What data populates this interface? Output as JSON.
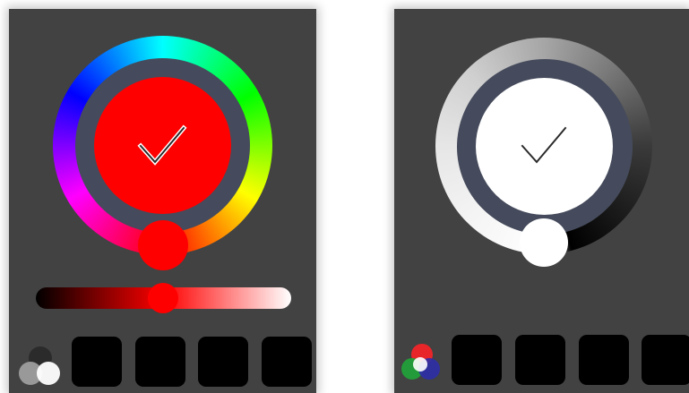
{
  "panels": [
    {
      "mode": "color",
      "selected_color": "#ff0000",
      "slider_position": 0.5,
      "preset_slots": [
        "#000000",
        "#000000",
        "#000000",
        "#000000"
      ],
      "icons": [
        "checkmark-icon",
        "grayscale-mode-icon"
      ]
    },
    {
      "mode": "white",
      "selected_color": "#ffffff",
      "preset_slots": [
        "#000000",
        "#000000",
        "#000000",
        "#000000"
      ],
      "icons": [
        "checkmark-icon",
        "rgb-mode-icon"
      ]
    }
  ],
  "colors": {
    "panel_background": "#424242",
    "inner_ring": "#454b5c",
    "preset_fill": "#000000"
  }
}
